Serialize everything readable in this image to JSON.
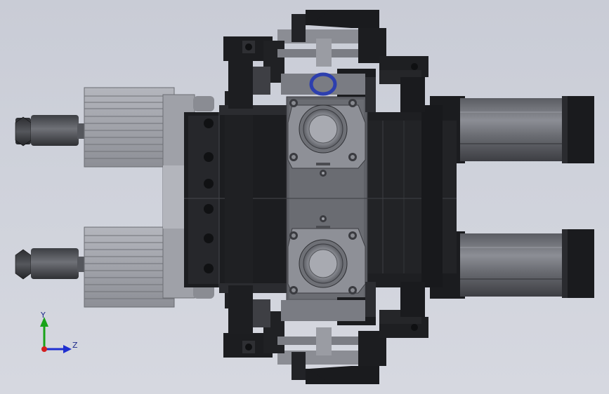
{
  "viewport": {
    "colors": {
      "background_top": "#c9ccd6",
      "background_bottom": "#d6d8e0",
      "dark_part": "#1c1d20",
      "mid_part": "#5c5e64",
      "light_part": "#9a9ca3",
      "cylinder_shell": "#a7a9b0",
      "o_ring": "#2d3fae"
    }
  },
  "triad": {
    "y_label": "Y",
    "z_label": "Z",
    "colors": {
      "y_axis": "#19a319",
      "z_axis": "#1f2fd0",
      "x_axis": "#d41f1f"
    }
  }
}
